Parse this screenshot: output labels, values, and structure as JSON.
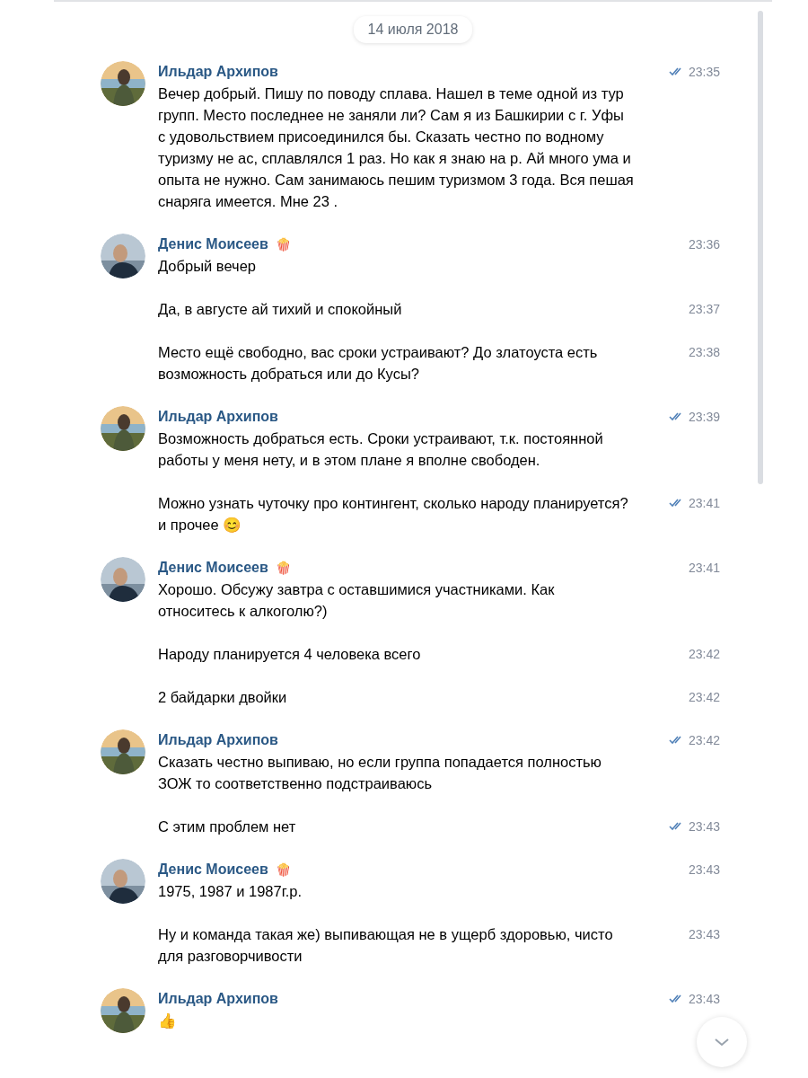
{
  "date": "14 июля 2018",
  "groups": [
    {
      "author": "Ильдар Архипов",
      "messages": [
        {
          "text": "Вечер добрый. Пишу по поводу сплава. Нашел в теме одной из тур групп. Место последнее не заняли ли? Сам я из Башкирии с г. Уфы с удовольствием присоединился бы. Сказать честно по водному туризму не ас, сплавлялся 1 раз. Но как я знаю на р. Ай много ума и опыта не нужно. Сам занимаюсь пешим туризмом 3 года. Вся пешая снаряга имеется. Мне 23 .",
          "time": "23:35",
          "read": true
        }
      ]
    },
    {
      "author": "Денис Моисеев",
      "badge": "🍿",
      "messages": [
        {
          "text": "Добрый вечер",
          "time": "23:36",
          "read": false
        },
        {
          "text": "Да, в августе ай тихий и спокойный",
          "time": "23:37",
          "read": false
        },
        {
          "text": "Место ещё свободно, вас сроки устраивают? До златоуста есть возможность добраться или до Кусы?",
          "time": "23:38",
          "read": false
        }
      ]
    },
    {
      "author": "Ильдар Архипов",
      "messages": [
        {
          "text": "Возможность добраться есть. Сроки устраивают, т.к. постоянной работы у меня нету, и в этом плане я вполне свободен.",
          "time": "23:39",
          "read": true
        },
        {
          "text": "Можно узнать чуточку про контингент, сколько народу планируется? и прочее 😊",
          "time": "23:41",
          "read": true
        }
      ]
    },
    {
      "author": "Денис Моисеев",
      "badge": "🍿",
      "messages": [
        {
          "text": "Хорошо. Обсужу завтра с оставшимися участниками. Как относитесь к алкоголю?)",
          "time": "23:41",
          "read": false
        },
        {
          "text": "Народу планируется 4 человека всего",
          "time": "23:42",
          "read": false
        },
        {
          "text": "2 байдарки двойки",
          "time": "23:42",
          "read": false
        }
      ]
    },
    {
      "author": "Ильдар Архипов",
      "messages": [
        {
          "text": "Сказать честно выпиваю, но если группа попадается полностью ЗОЖ то соответственно подстраиваюсь",
          "time": "23:42",
          "read": true
        },
        {
          "text": "С этим проблем нет",
          "time": "23:43",
          "read": true
        }
      ]
    },
    {
      "author": "Денис Моисеев",
      "badge": "🍿",
      "messages": [
        {
          "text": "1975, 1987 и 1987г.р.",
          "time": "23:43",
          "read": false
        },
        {
          "text": "Ну и команда такая же) выпивающая не в ущерб здоровью, чисто для разговорчивости",
          "time": "23:43",
          "read": false
        }
      ]
    },
    {
      "author": "Ильдар Архипов",
      "messages": [
        {
          "text": "👍",
          "time": "23:43",
          "read": true
        }
      ]
    }
  ]
}
